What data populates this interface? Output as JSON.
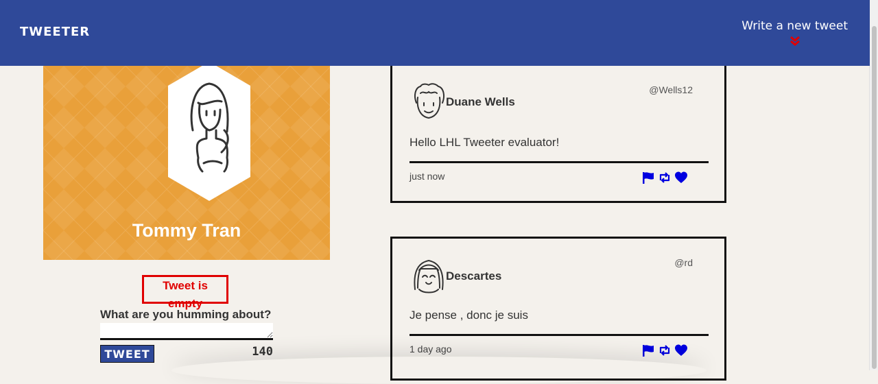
{
  "nav": {
    "brand": "TWEETER",
    "compose_label": "Write a new tweet",
    "compose_icon": "double-chevron-down-icon",
    "compose_icon_color": "#e00000"
  },
  "profile": {
    "name": "Tommy Tran",
    "background_color": "#e9a03a"
  },
  "composer": {
    "error_text": "Tweet is empty",
    "prompt": "What are you humming about?",
    "input_value": "",
    "button_label": "TWEET",
    "counter": "140"
  },
  "tweets": [
    {
      "name": "Duane Wells",
      "handle": "@Wells12",
      "content": "Hello LHL Tweeter evaluator!",
      "time": "just now",
      "avatar": "curly-hair-avatar-icon"
    },
    {
      "name": "Descartes",
      "handle": "@rd",
      "content": "Je pense , donc je suis",
      "time": "1 day ago",
      "avatar": "bangs-hair-avatar-icon"
    }
  ],
  "colors": {
    "nav": "#2f4999",
    "accent": "#0000e0",
    "error": "#e00000",
    "page": "#f4f1ec"
  }
}
